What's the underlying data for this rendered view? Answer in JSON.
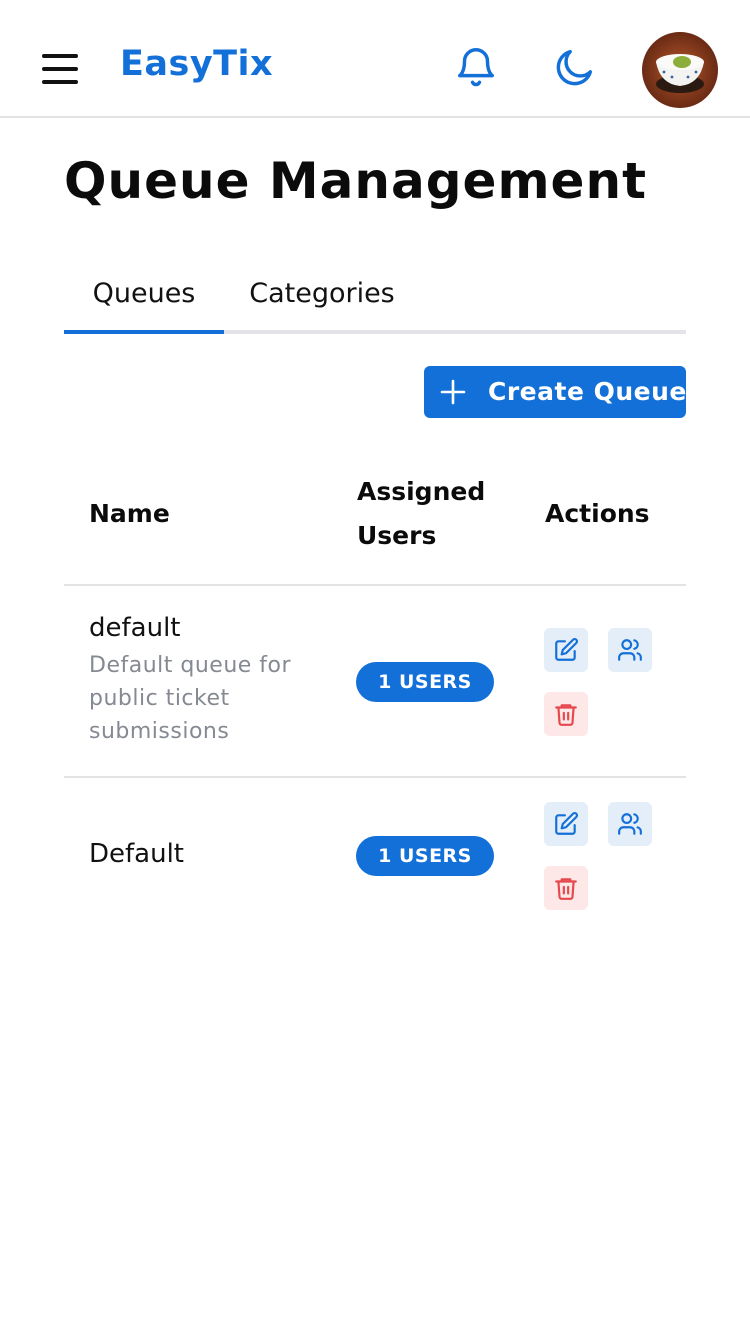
{
  "app": {
    "brand": "EasyTix",
    "icons": {
      "menu": "hamburger-menu-icon",
      "notifications": "bell-icon",
      "theme": "moon-icon",
      "avatar": "user-avatar"
    }
  },
  "page": {
    "title": "Queue Management",
    "tabs": [
      {
        "label": "Queues",
        "active": true
      },
      {
        "label": "Categories",
        "active": false
      }
    ],
    "create_button": {
      "label": "Create Queue",
      "icon": "plus-icon"
    }
  },
  "table": {
    "headers": {
      "name": "Name",
      "assigned_users": "Assigned Users",
      "actions": "Actions"
    },
    "rows": [
      {
        "name": "default",
        "description": "Default queue for public ticket submissions",
        "users_badge": "1 USERS",
        "actions": [
          "edit-icon",
          "users-icon",
          "trash-icon"
        ]
      },
      {
        "name": "Default",
        "description": "",
        "users_badge": "1 USERS",
        "actions": [
          "edit-icon",
          "users-icon",
          "trash-icon"
        ]
      }
    ]
  },
  "colors": {
    "accent": "#1370d8",
    "danger": "#e5484d",
    "muted_text": "#858991",
    "divider": "#e3e3e6"
  }
}
